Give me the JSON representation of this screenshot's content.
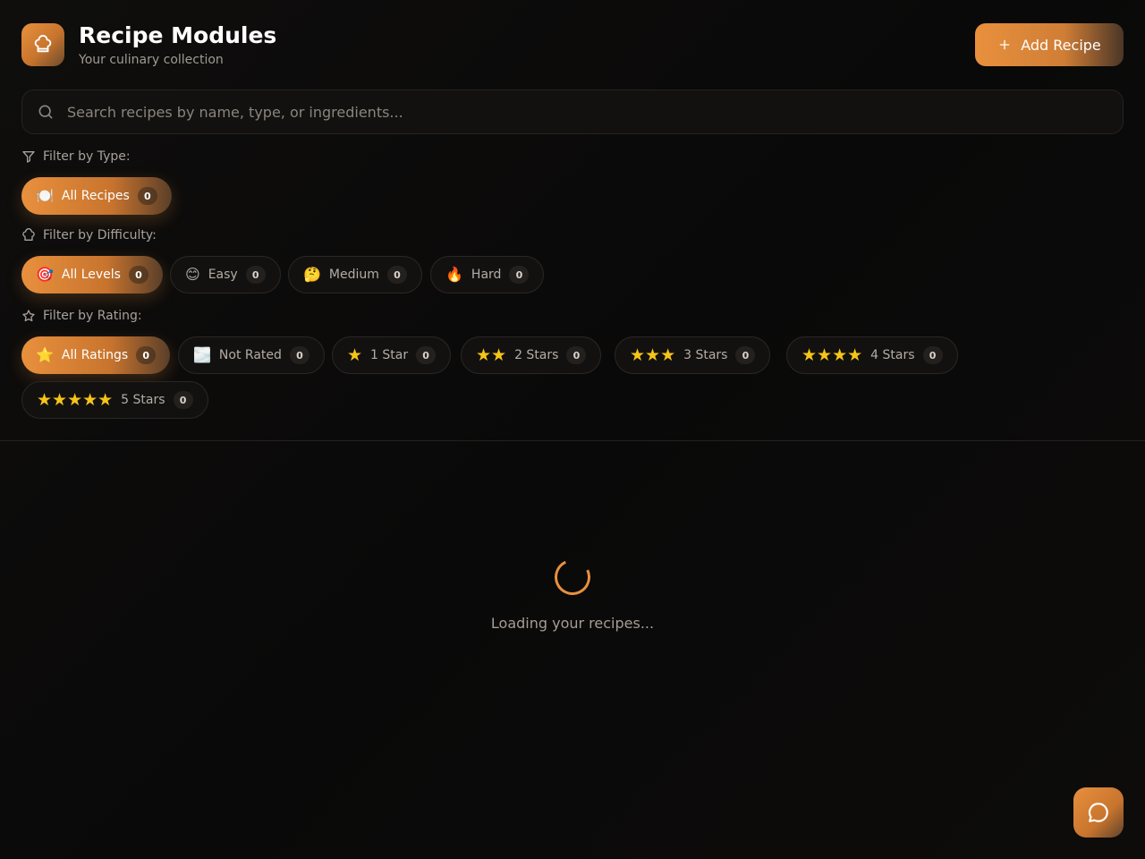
{
  "header": {
    "title": "Recipe Modules",
    "subtitle": "Your culinary collection",
    "add_button_label": "Add Recipe",
    "logo_icon": "chef-hat-icon",
    "accent_color": "#e8903d"
  },
  "search": {
    "placeholder": "Search recipes by name, type, or ingredients...",
    "value": ""
  },
  "filters": {
    "type": {
      "label": "Filter by Type:",
      "options": [
        {
          "emoji": "🍽️",
          "label": "All Recipes",
          "count": "0",
          "active": true
        }
      ]
    },
    "difficulty": {
      "label": "Filter by Difficulty:",
      "options": [
        {
          "emoji": "🎯",
          "label": "All Levels",
          "count": "0",
          "active": true
        },
        {
          "emoji": "😊",
          "label": "Easy",
          "count": "0",
          "active": false
        },
        {
          "emoji": "🤔",
          "label": "Medium",
          "count": "0",
          "active": false
        },
        {
          "emoji": "🔥",
          "label": "Hard",
          "count": "0",
          "active": false
        }
      ]
    },
    "rating": {
      "label": "Filter by Rating:",
      "options": [
        {
          "emoji": "⭐",
          "label": "All Ratings",
          "count": "0",
          "active": true
        },
        {
          "emoji": "🌫️",
          "label": "Not Rated",
          "count": "0",
          "active": false
        },
        {
          "stars": "★",
          "label": "1 Star",
          "count": "0",
          "active": false
        },
        {
          "stars": "★★",
          "label": "2 Stars",
          "count": "0",
          "active": false
        },
        {
          "stars": "★★★",
          "label": "3 Stars",
          "count": "0",
          "active": false
        },
        {
          "stars": "★★★★",
          "label": "4 Stars",
          "count": "0",
          "active": false
        },
        {
          "stars": "★★★★★",
          "label": "5 Stars",
          "count": "0",
          "active": false
        }
      ]
    }
  },
  "main": {
    "loading_text": "Loading your recipes..."
  },
  "chat": {
    "icon": "chat-bubble-icon"
  }
}
